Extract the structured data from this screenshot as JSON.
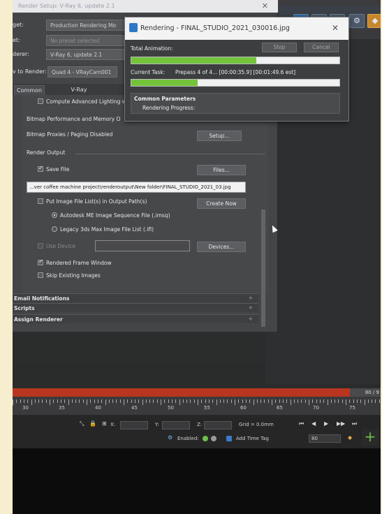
{
  "render_setup": {
    "title": "Render Setup: V-Ray 6, update 2.1",
    "target_label": "get:",
    "target_value": "Production Rendering Mo",
    "preset_label": "et:",
    "preset_value": "No preset selected",
    "renderer_label": "derer:",
    "renderer_value": "V-Ray 6, update 2.1",
    "view_label": "v to Render:",
    "view_value": "Quad 4 - VRayCam001",
    "tabs": [
      "Common",
      "V-Ray"
    ],
    "compute_lighting": "Compute Advanced Lighting wh",
    "bitmap_perf": "Bitmap Performance and Memory O",
    "bitmap_proxies": "Bitmap Proxies / Paging Disabled",
    "setup_button": "Setup...",
    "render_output_title": "Render Output",
    "save_file": "Save File",
    "files_button": "Files...",
    "output_path": "...ver coffee machine project\\renderoutput\\New folder\\FINAL_STUDIO_2021_03.jpg",
    "put_image_list": "Put Image File List(s) in Output Path(s)",
    "create_now": "Create Now",
    "autodesk_me": "Autodesk ME Image Sequence File (.imsq)",
    "legacy_3ds": "Legacy 3ds Max Image File List (.ifl)",
    "use_device": "Use Device",
    "devices_button": "Devices...",
    "rendered_frame_window": "Rendered Frame Window",
    "skip_existing": "Skip Existing Images",
    "rollouts": [
      "Email Notifications",
      "Scripts",
      "Assign Renderer"
    ],
    "rollout_plus": "+"
  },
  "rendering_dialog": {
    "title": "Rendering - FINAL_STUDIO_2021_030016.jpg",
    "close": "✕",
    "total_animation": "Total Animation:",
    "stop_button": "Stop",
    "cancel_button": "Cancel",
    "total_progress": 0.6,
    "current_task_label": "Current Task:",
    "current_task_value": "Prepass 4 of 4... [00:00:35.9] [00:01:49.6 est]",
    "task_progress": 0.32,
    "common_params": "Common Parameters",
    "rendering_progress": "Rendering Progress:"
  },
  "timeline": {
    "frame_counter": "80 / 9",
    "ticks": [
      "30",
      "35",
      "40",
      "45",
      "50",
      "55",
      "60",
      "65",
      "70",
      "75"
    ],
    "x_label": "X:",
    "y_label": "Y:",
    "z_label": "Z:",
    "grid": "Grid = 0.0mm",
    "enabled": "Enabled:",
    "add_time_tag": "Add Time Tag",
    "frame_field": "80"
  },
  "colors": {
    "progress_green": "#74c43b",
    "timeline_red": "#b93520",
    "accent_blue": "#2f78c8"
  }
}
